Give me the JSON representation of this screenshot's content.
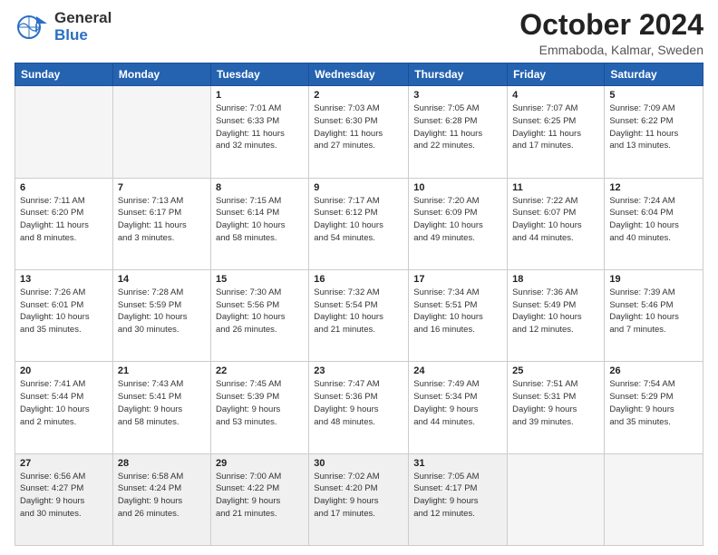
{
  "header": {
    "logo_general": "General",
    "logo_blue": "Blue",
    "month_title": "October 2024",
    "location": "Emmaboda, Kalmar, Sweden"
  },
  "weekdays": [
    "Sunday",
    "Monday",
    "Tuesday",
    "Wednesday",
    "Thursday",
    "Friday",
    "Saturday"
  ],
  "weeks": [
    [
      {
        "day": "",
        "empty": true,
        "info": ""
      },
      {
        "day": "",
        "empty": true,
        "info": ""
      },
      {
        "day": "1",
        "empty": false,
        "info": "Sunrise: 7:01 AM\nSunset: 6:33 PM\nDaylight: 11 hours\nand 32 minutes."
      },
      {
        "day": "2",
        "empty": false,
        "info": "Sunrise: 7:03 AM\nSunset: 6:30 PM\nDaylight: 11 hours\nand 27 minutes."
      },
      {
        "day": "3",
        "empty": false,
        "info": "Sunrise: 7:05 AM\nSunset: 6:28 PM\nDaylight: 11 hours\nand 22 minutes."
      },
      {
        "day": "4",
        "empty": false,
        "info": "Sunrise: 7:07 AM\nSunset: 6:25 PM\nDaylight: 11 hours\nand 17 minutes."
      },
      {
        "day": "5",
        "empty": false,
        "info": "Sunrise: 7:09 AM\nSunset: 6:22 PM\nDaylight: 11 hours\nand 13 minutes."
      }
    ],
    [
      {
        "day": "6",
        "empty": false,
        "info": "Sunrise: 7:11 AM\nSunset: 6:20 PM\nDaylight: 11 hours\nand 8 minutes."
      },
      {
        "day": "7",
        "empty": false,
        "info": "Sunrise: 7:13 AM\nSunset: 6:17 PM\nDaylight: 11 hours\nand 3 minutes."
      },
      {
        "day": "8",
        "empty": false,
        "info": "Sunrise: 7:15 AM\nSunset: 6:14 PM\nDaylight: 10 hours\nand 58 minutes."
      },
      {
        "day": "9",
        "empty": false,
        "info": "Sunrise: 7:17 AM\nSunset: 6:12 PM\nDaylight: 10 hours\nand 54 minutes."
      },
      {
        "day": "10",
        "empty": false,
        "info": "Sunrise: 7:20 AM\nSunset: 6:09 PM\nDaylight: 10 hours\nand 49 minutes."
      },
      {
        "day": "11",
        "empty": false,
        "info": "Sunrise: 7:22 AM\nSunset: 6:07 PM\nDaylight: 10 hours\nand 44 minutes."
      },
      {
        "day": "12",
        "empty": false,
        "info": "Sunrise: 7:24 AM\nSunset: 6:04 PM\nDaylight: 10 hours\nand 40 minutes."
      }
    ],
    [
      {
        "day": "13",
        "empty": false,
        "info": "Sunrise: 7:26 AM\nSunset: 6:01 PM\nDaylight: 10 hours\nand 35 minutes."
      },
      {
        "day": "14",
        "empty": false,
        "info": "Sunrise: 7:28 AM\nSunset: 5:59 PM\nDaylight: 10 hours\nand 30 minutes."
      },
      {
        "day": "15",
        "empty": false,
        "info": "Sunrise: 7:30 AM\nSunset: 5:56 PM\nDaylight: 10 hours\nand 26 minutes."
      },
      {
        "day": "16",
        "empty": false,
        "info": "Sunrise: 7:32 AM\nSunset: 5:54 PM\nDaylight: 10 hours\nand 21 minutes."
      },
      {
        "day": "17",
        "empty": false,
        "info": "Sunrise: 7:34 AM\nSunset: 5:51 PM\nDaylight: 10 hours\nand 16 minutes."
      },
      {
        "day": "18",
        "empty": false,
        "info": "Sunrise: 7:36 AM\nSunset: 5:49 PM\nDaylight: 10 hours\nand 12 minutes."
      },
      {
        "day": "19",
        "empty": false,
        "info": "Sunrise: 7:39 AM\nSunset: 5:46 PM\nDaylight: 10 hours\nand 7 minutes."
      }
    ],
    [
      {
        "day": "20",
        "empty": false,
        "info": "Sunrise: 7:41 AM\nSunset: 5:44 PM\nDaylight: 10 hours\nand 2 minutes."
      },
      {
        "day": "21",
        "empty": false,
        "info": "Sunrise: 7:43 AM\nSunset: 5:41 PM\nDaylight: 9 hours\nand 58 minutes."
      },
      {
        "day": "22",
        "empty": false,
        "info": "Sunrise: 7:45 AM\nSunset: 5:39 PM\nDaylight: 9 hours\nand 53 minutes."
      },
      {
        "day": "23",
        "empty": false,
        "info": "Sunrise: 7:47 AM\nSunset: 5:36 PM\nDaylight: 9 hours\nand 48 minutes."
      },
      {
        "day": "24",
        "empty": false,
        "info": "Sunrise: 7:49 AM\nSunset: 5:34 PM\nDaylight: 9 hours\nand 44 minutes."
      },
      {
        "day": "25",
        "empty": false,
        "info": "Sunrise: 7:51 AM\nSunset: 5:31 PM\nDaylight: 9 hours\nand 39 minutes."
      },
      {
        "day": "26",
        "empty": false,
        "info": "Sunrise: 7:54 AM\nSunset: 5:29 PM\nDaylight: 9 hours\nand 35 minutes."
      }
    ],
    [
      {
        "day": "27",
        "empty": false,
        "last": true,
        "info": "Sunrise: 6:56 AM\nSunset: 4:27 PM\nDaylight: 9 hours\nand 30 minutes."
      },
      {
        "day": "28",
        "empty": false,
        "last": true,
        "info": "Sunrise: 6:58 AM\nSunset: 4:24 PM\nDaylight: 9 hours\nand 26 minutes."
      },
      {
        "day": "29",
        "empty": false,
        "last": true,
        "info": "Sunrise: 7:00 AM\nSunset: 4:22 PM\nDaylight: 9 hours\nand 21 minutes."
      },
      {
        "day": "30",
        "empty": false,
        "last": true,
        "info": "Sunrise: 7:02 AM\nSunset: 4:20 PM\nDaylight: 9 hours\nand 17 minutes."
      },
      {
        "day": "31",
        "empty": false,
        "last": true,
        "info": "Sunrise: 7:05 AM\nSunset: 4:17 PM\nDaylight: 9 hours\nand 12 minutes."
      },
      {
        "day": "",
        "empty": true,
        "last": true,
        "info": ""
      },
      {
        "day": "",
        "empty": true,
        "last": true,
        "info": ""
      }
    ]
  ]
}
